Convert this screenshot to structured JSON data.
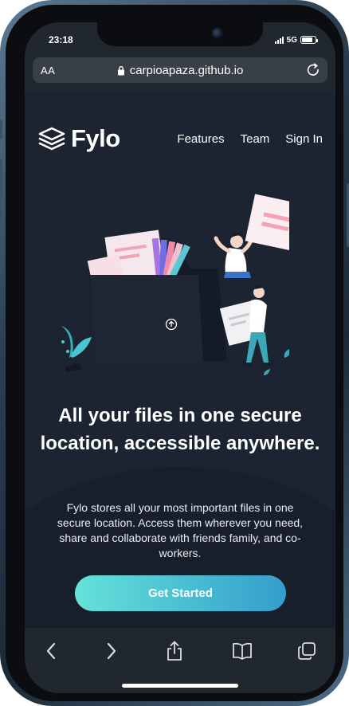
{
  "status_bar": {
    "time": "23:18",
    "network": "5G",
    "battery_level": 0.8
  },
  "browser": {
    "text_size_label": "AA",
    "url": "carpioapaza.github.io",
    "icons": {
      "lock": "lock-icon",
      "reload": "reload-icon",
      "back": "chevron-left-icon",
      "forward": "chevron-right-icon",
      "share": "share-icon",
      "bookmarks": "book-icon",
      "tabs": "tabs-icon"
    }
  },
  "site": {
    "logo_text": "Fylo",
    "nav": [
      "Features",
      "Team",
      "Sign In"
    ],
    "hero_title": "All your files in one secure location, accessible anywhere.",
    "hero_text": "Fylo stores all your most important files in one secure location. Access them wherever you need, share and collaborate with friends family, and co-workers.",
    "cta_label": "Get Started"
  },
  "colors": {
    "page_background": "#1c2331",
    "browser_chrome": "#20272e",
    "accent_start": "#65e2d9",
    "accent_end": "#339ecc",
    "text": "#ffffff"
  }
}
